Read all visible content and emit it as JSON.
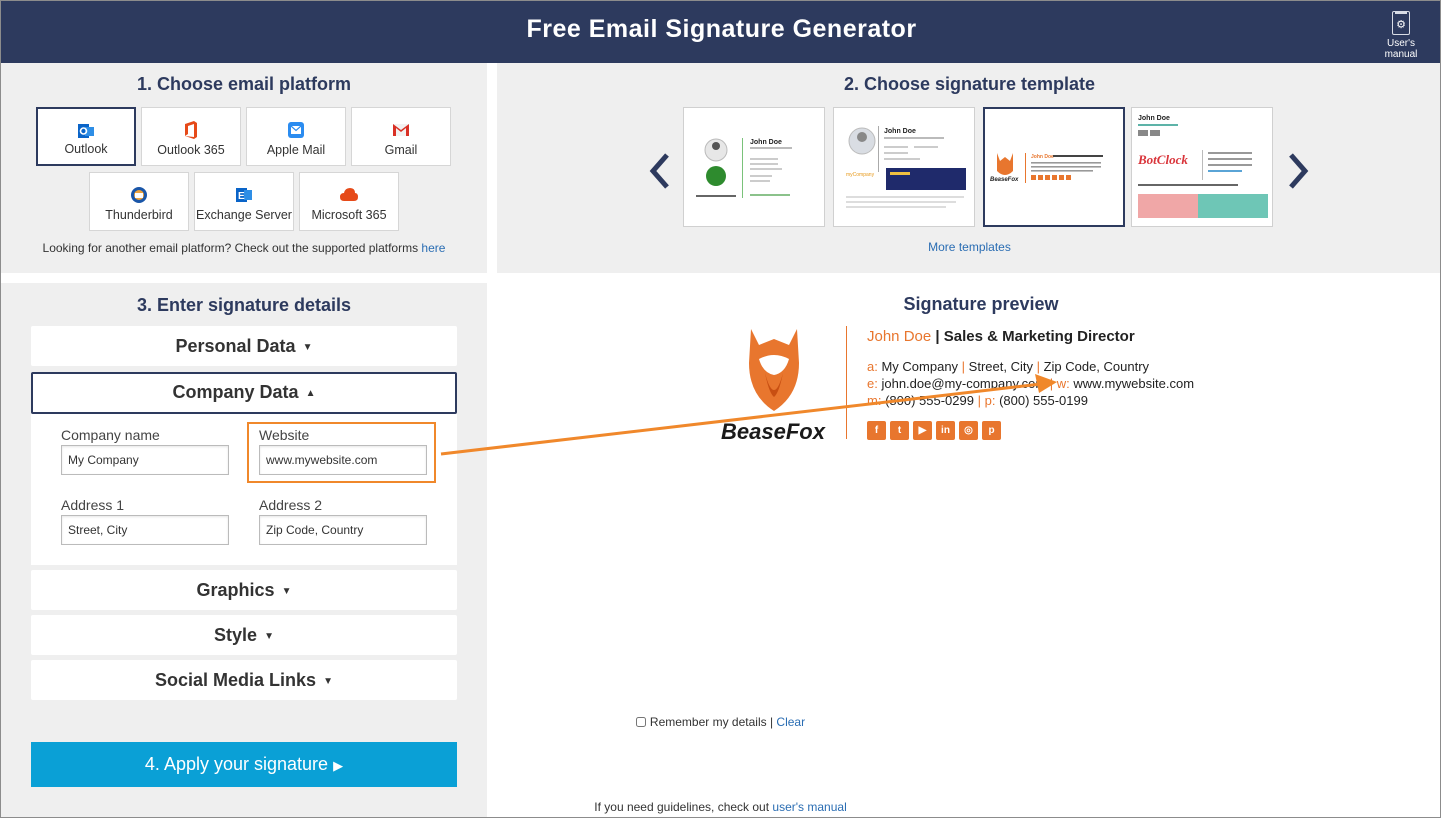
{
  "header": {
    "title": "Free Email Signature Generator",
    "manual_label": "User's manual"
  },
  "step1": {
    "title": "1. Choose email platform",
    "platforms": [
      {
        "label": "Outlook"
      },
      {
        "label": "Outlook 365"
      },
      {
        "label": "Apple Mail"
      },
      {
        "label": "Gmail"
      },
      {
        "label": "Thunderbird"
      },
      {
        "label": "Exchange Server"
      },
      {
        "label": "Microsoft 365"
      }
    ],
    "selected": "Outlook",
    "note": "Looking for another email platform? Check out the supported platforms",
    "note_link": "here"
  },
  "step2": {
    "title": "2. Choose signature template",
    "more_templates": "More templates",
    "templates": [
      {
        "name": "John Doe",
        "brand": ""
      },
      {
        "name": "John Doe",
        "brand": "myCompany"
      },
      {
        "name": "John Doe",
        "brand": "BeaseFox"
      },
      {
        "name": "John Doe",
        "brand": "BotClock"
      }
    ],
    "selected_index": 2
  },
  "step3": {
    "title": "3. Enter signature details",
    "sections": {
      "personal": "Personal Data",
      "company": "Company Data",
      "graphics": "Graphics",
      "style": "Style",
      "social": "Social Media Links"
    },
    "company_fields": {
      "company_name_label": "Company name",
      "company_name_value": "My Company",
      "website_label": "Website",
      "website_value": "www.mywebsite.com",
      "address1_label": "Address 1",
      "address1_value": "Street, City",
      "address2_label": "Address 2",
      "address2_value": "Zip Code, Country"
    },
    "remember_label": "Remember my details",
    "clear_label": "Clear"
  },
  "apply": {
    "label": "4. Apply your signature"
  },
  "guidelines": {
    "text": "If you need guidelines, check out",
    "link": "user's manual"
  },
  "preview": {
    "title": "Signature preview",
    "logo_text": "BeaseFox",
    "name": "John Doe",
    "position": "Sales & Marketing Director",
    "address_prefix": "a:",
    "company": "My Company",
    "street": "Street, City",
    "zip": "Zip Code, Country",
    "email_prefix": "e:",
    "email": "john.doe@my-company.com",
    "web_prefix": "w:",
    "website": "www.mywebsite.com",
    "mobile_prefix": "m:",
    "mobile": "(800) 555-0299",
    "phone_prefix": "p:",
    "phone": "(800) 555-0199",
    "social_icons": [
      "facebook-icon",
      "twitter-icon",
      "youtube-icon",
      "linkedin-icon",
      "instagram-icon",
      "pinterest-icon"
    ]
  },
  "colors": {
    "header_bg": "#2d3a5e",
    "accent": "#e8762e",
    "apply_button": "#0aa0d6",
    "link": "#2a6db3"
  }
}
